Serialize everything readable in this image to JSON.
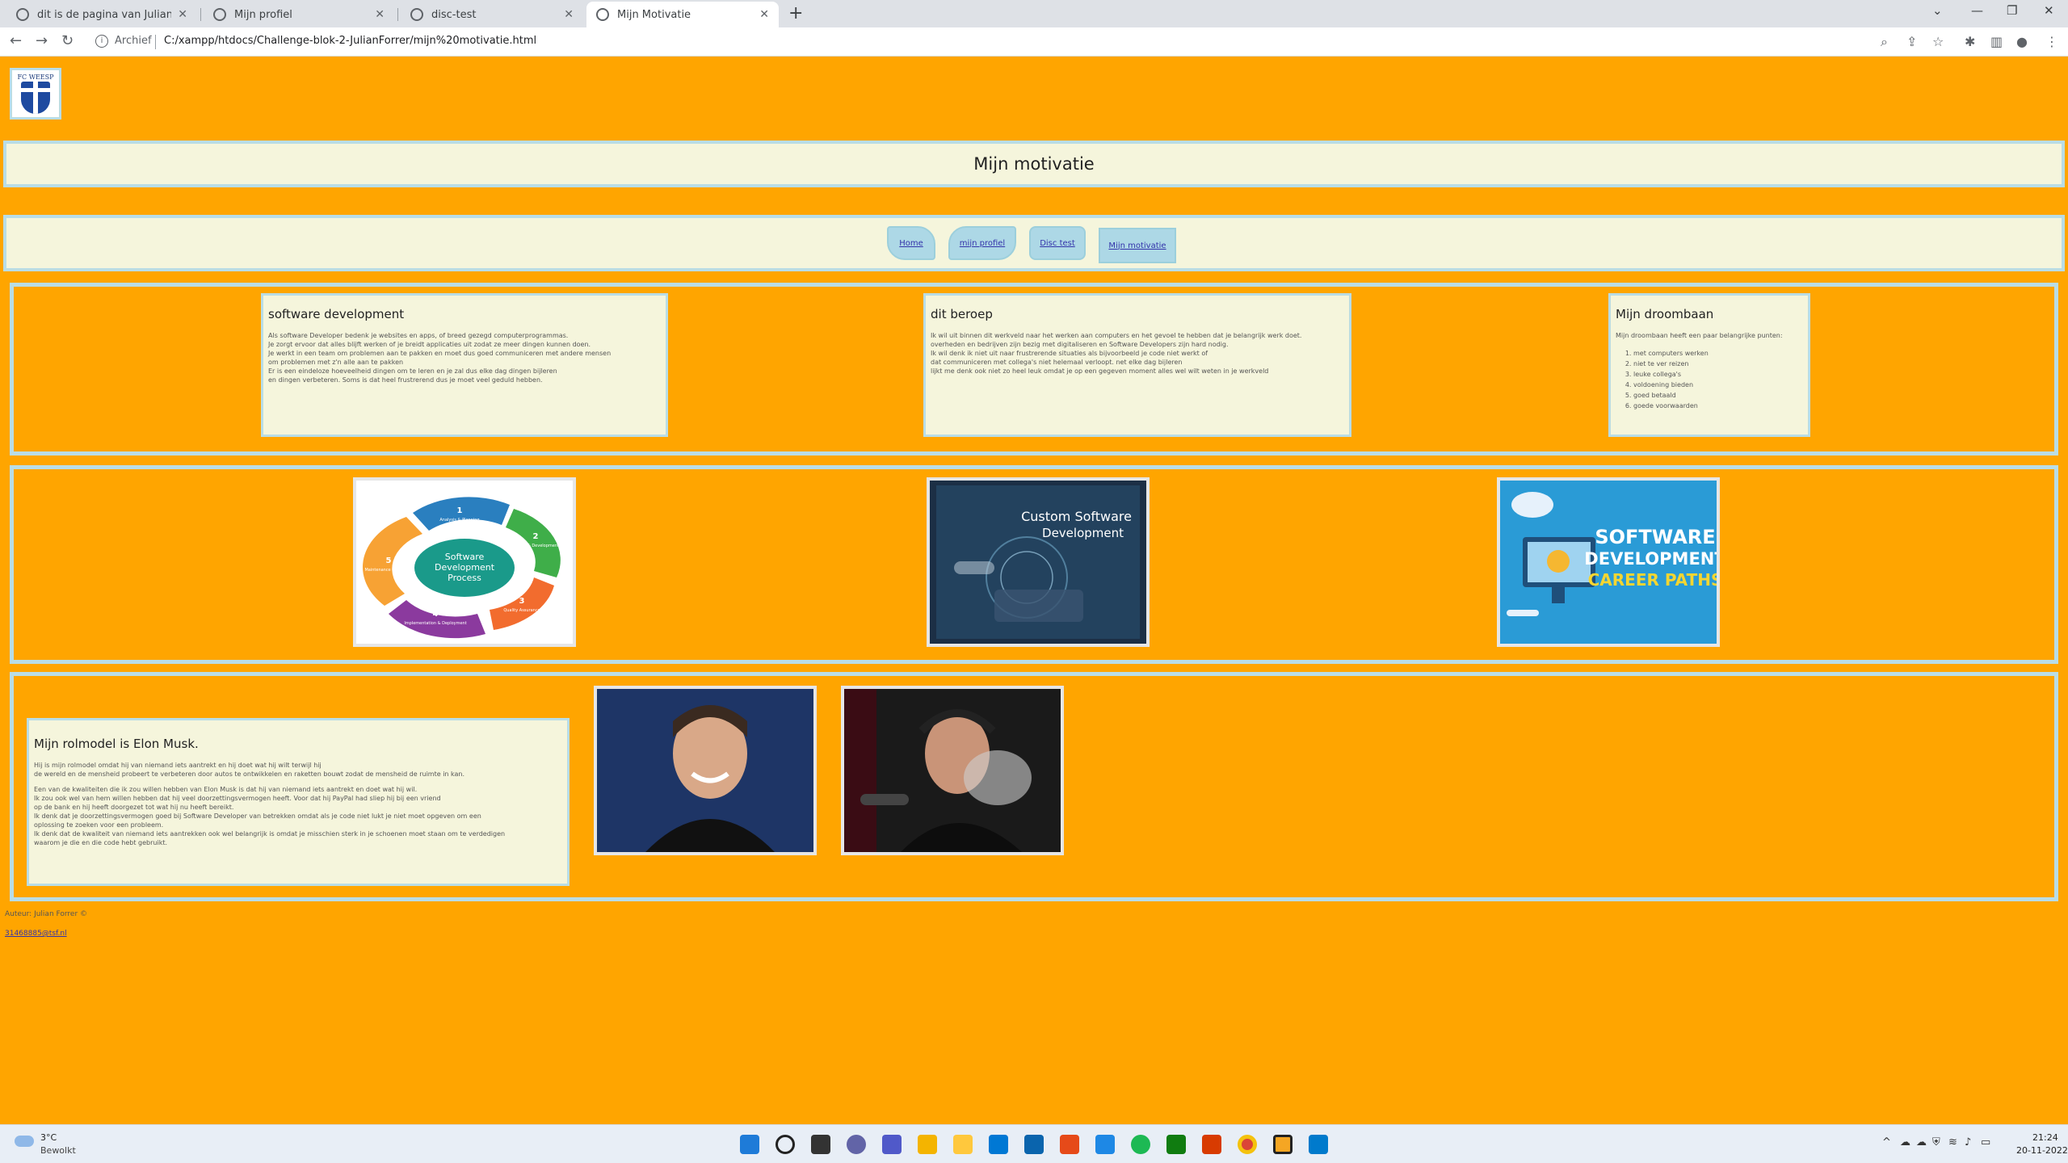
{
  "browser": {
    "tabs": [
      {
        "title": "dit is de pagina van Julian Forrer",
        "close": "✕"
      },
      {
        "title": "Mijn profiel",
        "close": "✕"
      },
      {
        "title": "disc-test",
        "close": "✕"
      },
      {
        "title": "Mijn Motivatie",
        "close": "✕"
      }
    ],
    "new_tab": "+",
    "address_label": "Archief",
    "address_url": "C:/xampp/htdocs/Challenge-blok-2-JulianForrer/mijn%20motivatie.html"
  },
  "page": {
    "logo_text": "FC WEESP",
    "header_title": "Mijn motivatie",
    "nav": [
      "Home",
      "mijn profiel",
      "Disc test",
      "Mijn motivatie"
    ],
    "cards": {
      "software": {
        "title": "software development",
        "lines": [
          "Als software Developer bedenk je websites en apps, of breed gezegd computerprogrammas.",
          "Je zorgt ervoor dat alles blijft werken of je breidt applicaties uit zodat ze meer dingen kunnen doen.",
          "Je werkt in een team om problemen aan te pakken en moet dus goed communiceren met andere mensen",
          "om problemen met z'n alle aan te pakken",
          "Er is een eindeloze hoeveelheid dingen om te leren en je zal dus elke dag dingen bijleren",
          "en dingen verbeteren. Soms is dat heel frustrerend dus je moet veel geduld hebben."
        ]
      },
      "beroep": {
        "title": "dit beroep",
        "lines": [
          "Ik wil uit binnen dit werkveld naar het werken aan computers en het gevoel te hebben dat je belangrijk werk doet.",
          "overheden en bedrijven zijn bezig met digitaliseren en Software Developers zijn hard nodig.",
          "Ik wil denk ik niet uit naar frustrerende situaties als bijvoorbeeld je code niet werkt of",
          "dat communiceren met collega's niet helemaal verloopt. net elke dag bijleren",
          "lijkt me denk ook niet zo heel leuk omdat je op een gegeven moment alles wel wilt weten in je werkveld"
        ]
      },
      "droombaan": {
        "title": "Mijn droombaan",
        "intro": "Mijn droombaan heeft een paar belangrijke punten:",
        "items": [
          "met computers werken",
          "niet te ver reizen",
          "leuke collega's",
          "voldoening bieden",
          "goed betaald",
          "goede voorwaarden"
        ]
      },
      "rolmodel": {
        "title": "Mijn rolmodel is Elon Musk.",
        "lines": [
          "Hij is mijn rolmodel omdat hij van niemand iets aantrekt en hij doet wat hij wilt terwijl hij",
          "de wereld en de mensheid probeert te verbeteren door autos te ontwikkelen en raketten bouwt zodat de mensheid de ruimte in kan.",
          "",
          "Een van de kwaliteiten die ik zou willen hebben van Elon Musk is dat hij van niemand iets aantrekt en doet wat hij wil.",
          "Ik zou ook wel van hem willen hebben dat hij veel doorzettingsvermogen heeft. Voor dat hij PayPal had sliep hij bij een vriend",
          "op de bank en hij heeft doorgezet tot wat hij nu heeft bereikt.",
          "Ik denk dat je doorzettingsvermogen goed bij Software Developer van betrekken omdat als je code niet lukt je niet moet opgeven om een",
          "oplossing te zoeken voor een probleem.",
          "Ik denk dat de kwaliteit van niemand iets aantrekken ook wel belangrijk is omdat je misschien sterk in je schoenen moet staan om te verdedigen",
          "waarom je die en die code hebt gebruikt."
        ]
      }
    },
    "images": {
      "process": {
        "center": [
          "Software",
          "Development",
          "Process"
        ],
        "steps": [
          {
            "num": "1",
            "label": "Analysis & Planning"
          },
          {
            "num": "2",
            "label": "Design & Development"
          },
          {
            "num": "3",
            "label": "Quality Assurance"
          },
          {
            "num": "4",
            "label": "Implementation & Deployment"
          },
          {
            "num": "5",
            "label": "Maintenance & Support"
          }
        ]
      },
      "custom": {
        "line1": "Custom Software",
        "line2": "Development"
      },
      "career": {
        "line1": "SOFTWARE",
        "line2": "DEVELOPMENT",
        "line3": "CAREER PATHS"
      }
    },
    "footer": {
      "author": "Auteur: Julian Forrer ©",
      "email": "31468885@tsf.nl"
    }
  },
  "taskbar": {
    "temp": "3°C",
    "weather": "Bewolkt",
    "time": "21:24",
    "date": "20-11-2022"
  }
}
